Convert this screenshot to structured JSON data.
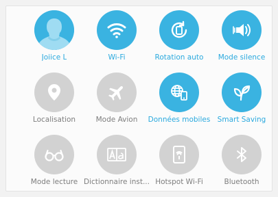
{
  "colors": {
    "active": "#3ab3e1",
    "inactive": "#d2d2d2",
    "active_label": "#2aa9de",
    "inactive_label": "#7d7d7d"
  },
  "tiles": [
    {
      "label": "Joiice L",
      "icon": "avatar",
      "active": true
    },
    {
      "label": "Wi-Fi",
      "icon": "wifi-icon",
      "active": true
    },
    {
      "label": "Rotation auto",
      "icon": "rotation-icon",
      "active": true
    },
    {
      "label": "Mode silence",
      "icon": "vibrate-icon",
      "active": true
    },
    {
      "label": "Localisation",
      "icon": "location-pin-icon",
      "active": false
    },
    {
      "label": "Mode Avion",
      "icon": "airplane-icon",
      "active": false
    },
    {
      "label": "Données mobiles",
      "icon": "mobile-data-icon",
      "active": true
    },
    {
      "label": "Smart Saving",
      "icon": "leaf-icon",
      "active": true
    },
    {
      "label": "Mode lecture",
      "icon": "glasses-icon",
      "active": false
    },
    {
      "label": "Dictionnaire inst...",
      "icon": "dictionary-icon",
      "active": false
    },
    {
      "label": "Hotspot Wi-Fi",
      "icon": "hotspot-icon",
      "active": false
    },
    {
      "label": "Bluetooth",
      "icon": "bluetooth-icon",
      "active": false
    }
  ]
}
